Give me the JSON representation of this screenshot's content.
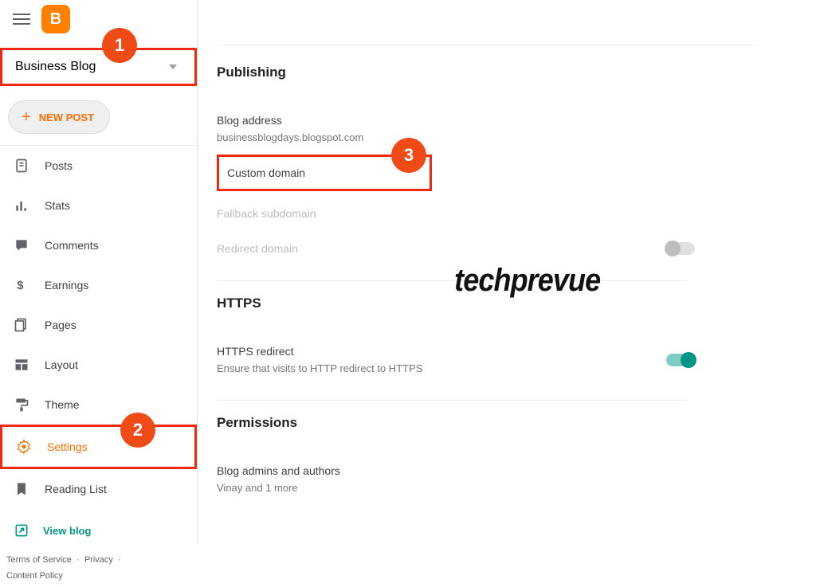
{
  "header": {
    "blog_name": "Business Blog",
    "new_post_label": "NEW POST"
  },
  "sidebar": {
    "items": [
      {
        "key": "posts",
        "label": "Posts"
      },
      {
        "key": "stats",
        "label": "Stats"
      },
      {
        "key": "comments",
        "label": "Comments"
      },
      {
        "key": "earnings",
        "label": "Earnings"
      },
      {
        "key": "pages",
        "label": "Pages"
      },
      {
        "key": "layout",
        "label": "Layout"
      },
      {
        "key": "theme",
        "label": "Theme"
      },
      {
        "key": "settings",
        "label": "Settings"
      },
      {
        "key": "reading_list",
        "label": "Reading List"
      }
    ],
    "view_blog": "View blog",
    "footer": {
      "terms": "Terms of Service",
      "privacy": "Privacy",
      "content_policy": "Content Policy"
    }
  },
  "main": {
    "publishing": {
      "title": "Publishing",
      "blog_address": {
        "label": "Blog address",
        "value": "businessblogdays.blogspot.com"
      },
      "custom_domain": {
        "label": "Custom domain"
      },
      "fallback": {
        "label": "Fallback subdomain"
      },
      "redirect": {
        "label": "Redirect domain",
        "on": false
      }
    },
    "https": {
      "title": "HTTPS",
      "redirect": {
        "label": "HTTPS redirect",
        "description": "Ensure that visits to HTTP redirect to HTTPS",
        "on": true
      }
    },
    "permissions": {
      "title": "Permissions",
      "admins": {
        "label": "Blog admins and authors",
        "value": "Vinay and 1 more"
      }
    }
  },
  "annotations": {
    "one": "1",
    "two": "2",
    "three": "3"
  },
  "watermark": "techprevue"
}
